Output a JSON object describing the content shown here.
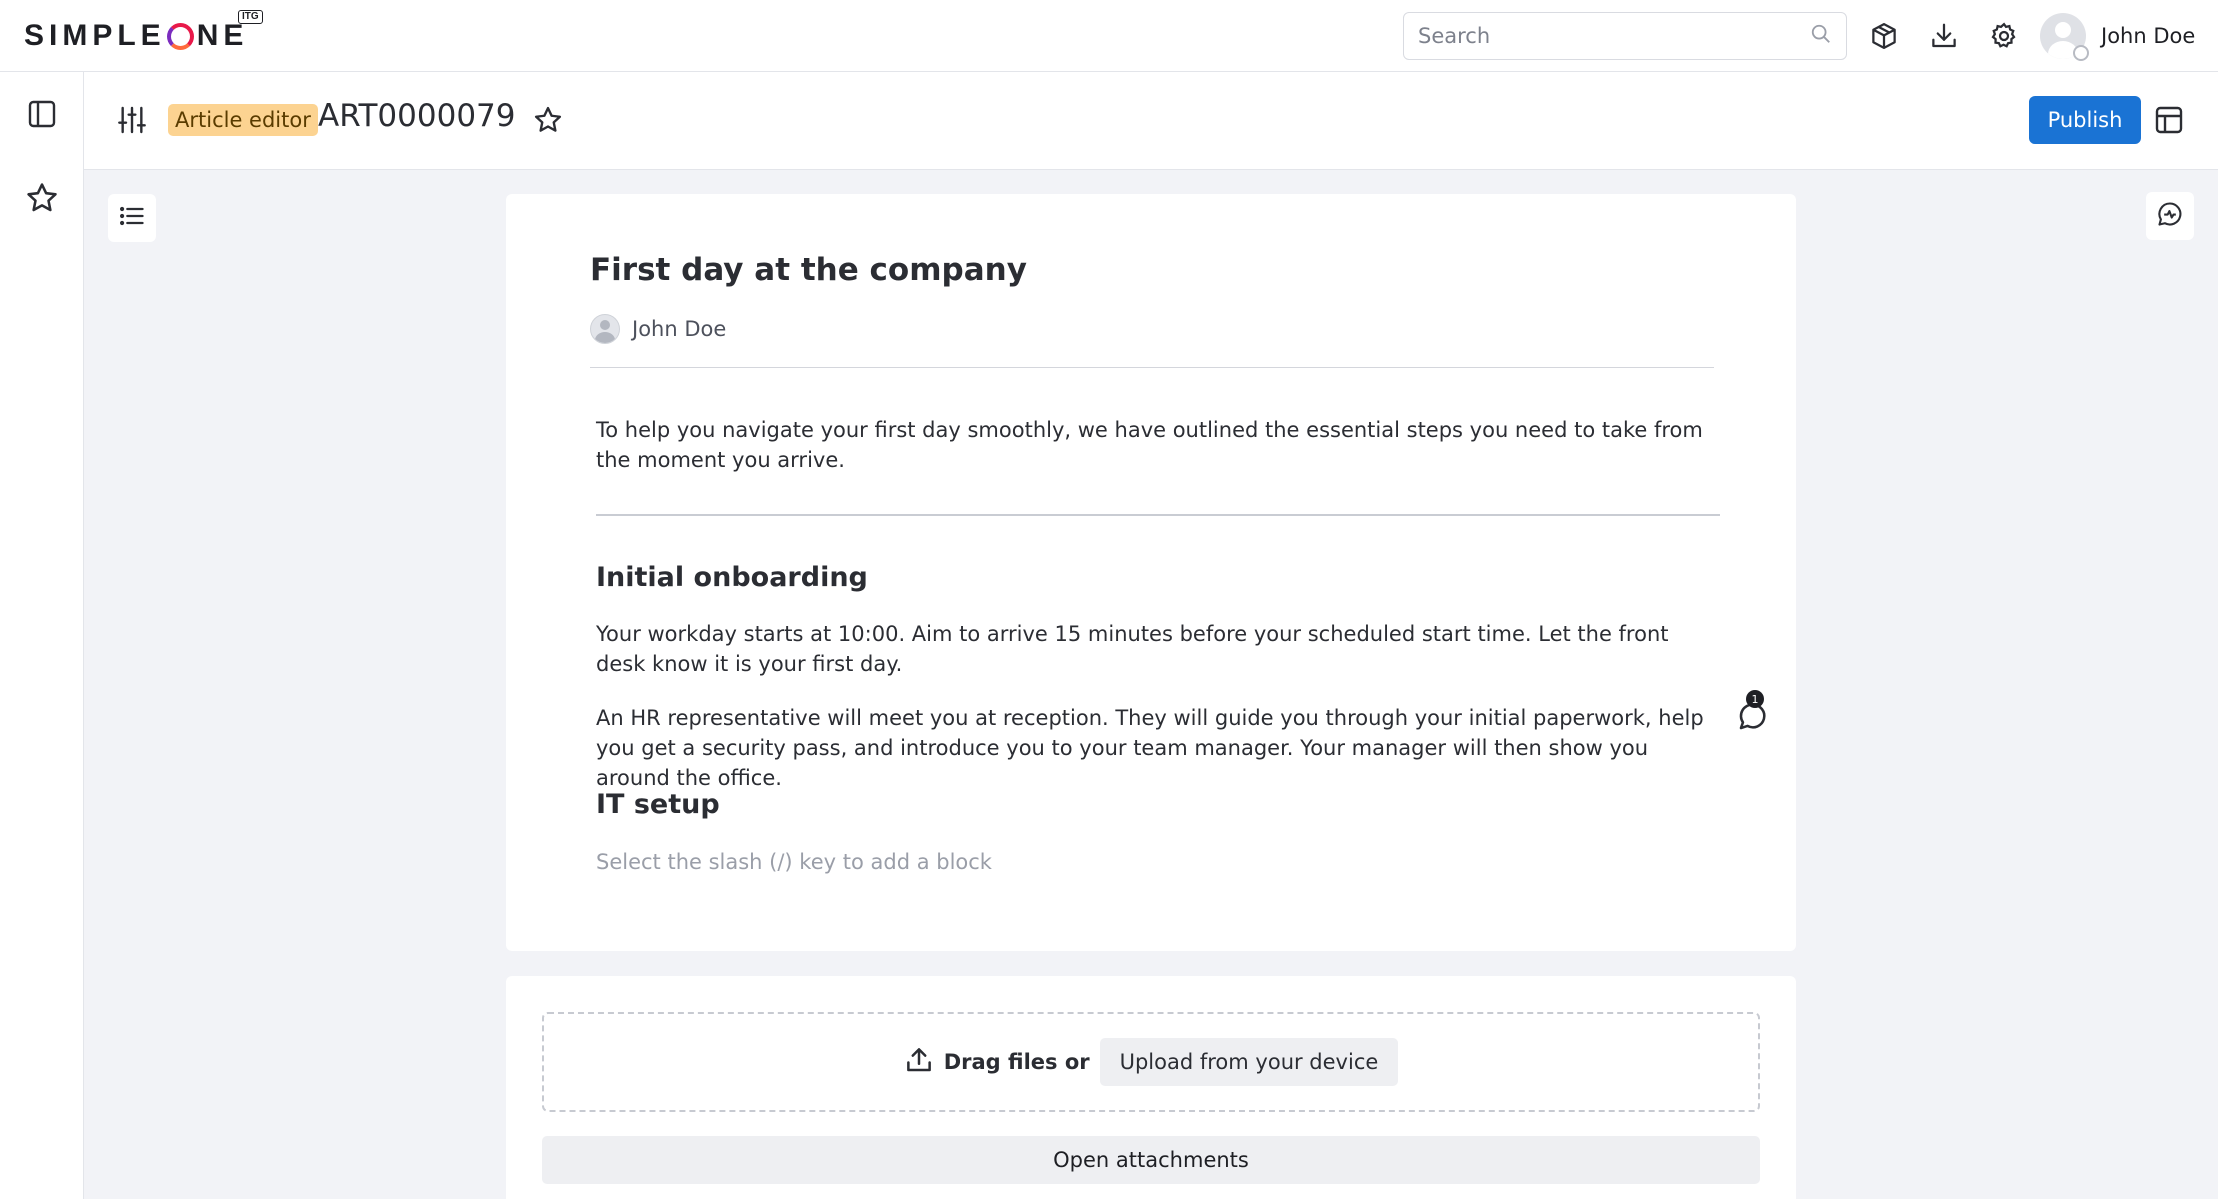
{
  "header": {
    "logo_text_a": "SIMPLE",
    "logo_text_b": "NE",
    "logo_badge": "ITG",
    "search_placeholder": "Search",
    "icons": [
      "search-icon",
      "package-icon",
      "download-icon",
      "gear-icon"
    ],
    "user_name": "John Doe"
  },
  "sidebar": {
    "items": [
      {
        "icon": "sidebar-toggle-icon"
      },
      {
        "icon": "star-icon"
      }
    ]
  },
  "toolbar": {
    "badge": "Article editor",
    "record_id": "ART0000079",
    "publish_label": "Publish"
  },
  "article": {
    "title": "First day at the company",
    "author": "John Doe",
    "intro": "To help you navigate your first day smoothly, we have outlined the essential steps you need to take from the moment you arrive.",
    "section1_heading": "Initial onboarding",
    "section1_p1": "Your workday starts at 10:00. Aim to arrive 15 minutes before your scheduled start time. Let the front desk know it is your first day.",
    "section1_p2": "An HR representative will meet you at reception. They will guide you through your initial paperwork, help you get a security pass, and introduce you to your team manager. Your manager will then show you around the office.",
    "section2_heading": "IT setup",
    "block_hint": "Select the slash (/) key to add a block",
    "comment_count": "1"
  },
  "attachments": {
    "drag_text": "Drag files or",
    "upload_label": "Upload from your device",
    "open_label": "Open attachments"
  },
  "colors": {
    "primary": "#1a73d4",
    "badge_bg": "#fcd391",
    "page_bg": "#f2f3f7"
  }
}
